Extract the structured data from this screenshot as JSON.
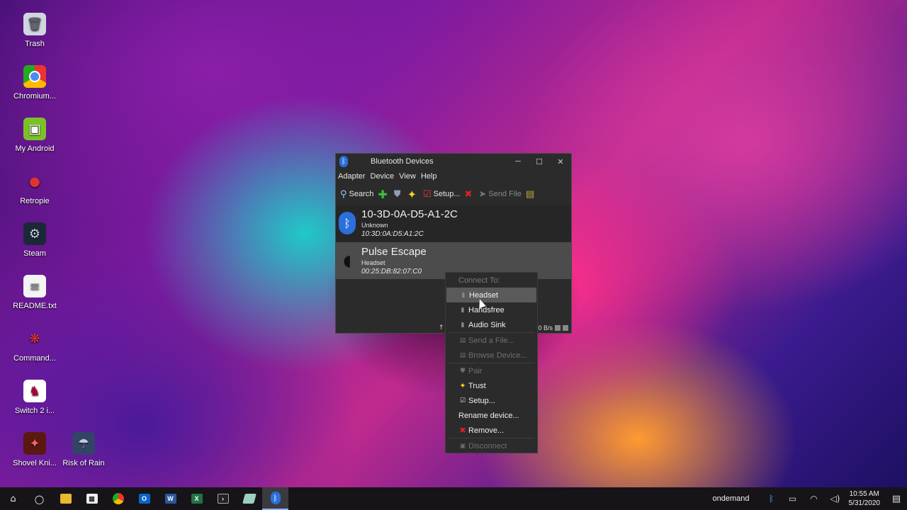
{
  "desktop": {
    "icons": [
      {
        "label": "Trash",
        "icon": "trash-icon"
      },
      {
        "label": "Chromium...",
        "icon": "chromium-icon"
      },
      {
        "label": "My Android",
        "icon": "android-icon"
      },
      {
        "label": "Retropie",
        "icon": "joystick-icon"
      },
      {
        "label": "Steam",
        "icon": "steam-icon"
      },
      {
        "label": "README.txt",
        "icon": "text-file-icon"
      },
      {
        "label": "Command...",
        "icon": "command-icon"
      },
      {
        "label": "Switch 2 i...",
        "icon": "switch-icon"
      },
      {
        "label": "Shovel Kni...",
        "icon": "shovel-knight-icon"
      },
      {
        "label": "Risk of Rain",
        "icon": "risk-of-rain-icon"
      }
    ]
  },
  "window": {
    "title": "Bluetooth Devices",
    "menu": [
      "Adapter",
      "Device",
      "View",
      "Help"
    ],
    "toolbar": {
      "search": "Search",
      "setup": "Setup...",
      "send_file": "Send File"
    },
    "devices": [
      {
        "name": "10-3D-0A-D5-A1-2C",
        "type": "Unknown",
        "address": "10:3D:0A:D5:A1:2C",
        "icon": "bluetooth-icon"
      },
      {
        "name": "Pulse Escape",
        "type": "Headset",
        "address": "00:25:DB:82:07:C0",
        "icon": "headset-icon"
      }
    ],
    "status": {
      "rate": "0 B/s"
    }
  },
  "context_menu": {
    "connect_to": "Connect To:",
    "headset": "Headset",
    "handsfree": "Handsfree",
    "audio_sink": "Audio Sink",
    "send_file": "Send a File...",
    "browse_device": "Browse Device...",
    "pair": "Pair",
    "trust": "Trust",
    "setup": "Setup...",
    "rename": "Rename device...",
    "remove": "Remove...",
    "disconnect": "Disconnect"
  },
  "taskbar": {
    "user": "ondemand",
    "time": "10:55 AM",
    "date": "5/31/2020"
  },
  "colors": {
    "accent": "#2a6fdb",
    "taskbar": "#161418",
    "window_bg": "#2b2b2b",
    "selection": "#4c4c4c"
  }
}
